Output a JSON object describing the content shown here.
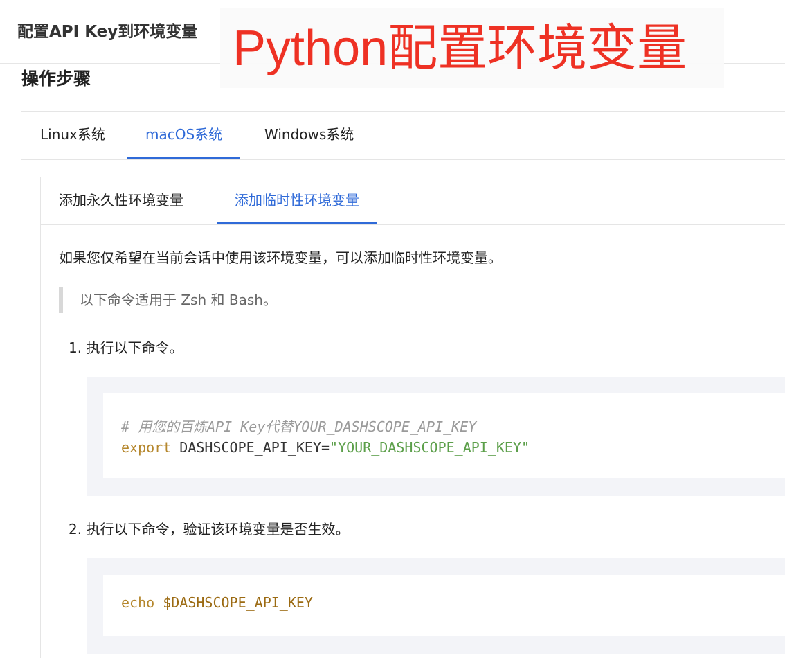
{
  "header": {
    "doc_title": "配置API Key到环境变量",
    "overlay_title": "Python配置环境变量"
  },
  "section": {
    "heading": "操作步骤"
  },
  "os_tabs": [
    {
      "label": "Linux系统",
      "active": false
    },
    {
      "label": "macOS系统",
      "active": true
    },
    {
      "label": "Windows系统",
      "active": false
    }
  ],
  "mode_tabs": [
    {
      "label": "添加永久性环境变量",
      "active": false
    },
    {
      "label": "添加临时性环境变量",
      "active": true
    }
  ],
  "content": {
    "intro": "如果您仅希望在当前会话中使用该环境变量，可以添加临时性环境变量。",
    "note": "以下命令适用于 Zsh 和 Bash。",
    "step1": "1. 执行以下命令。",
    "step2": "2. 执行以下命令，验证该环境变量是否生效。"
  },
  "code1": {
    "comment": "# 用您的百炼API Key代替YOUR_DASHSCOPE_API_KEY",
    "keyword": "export",
    "var_assign": "DASHSCOPE_API_KEY=",
    "value": "\"YOUR_DASHSCOPE_API_KEY\""
  },
  "code2": {
    "keyword": "echo",
    "var": "$DASHSCOPE_API_KEY"
  },
  "colors": {
    "accent": "#2f6ad8",
    "overlay_red": "#ee3124",
    "code_keyword": "#b5872d",
    "code_string": "#5c9f4a"
  }
}
